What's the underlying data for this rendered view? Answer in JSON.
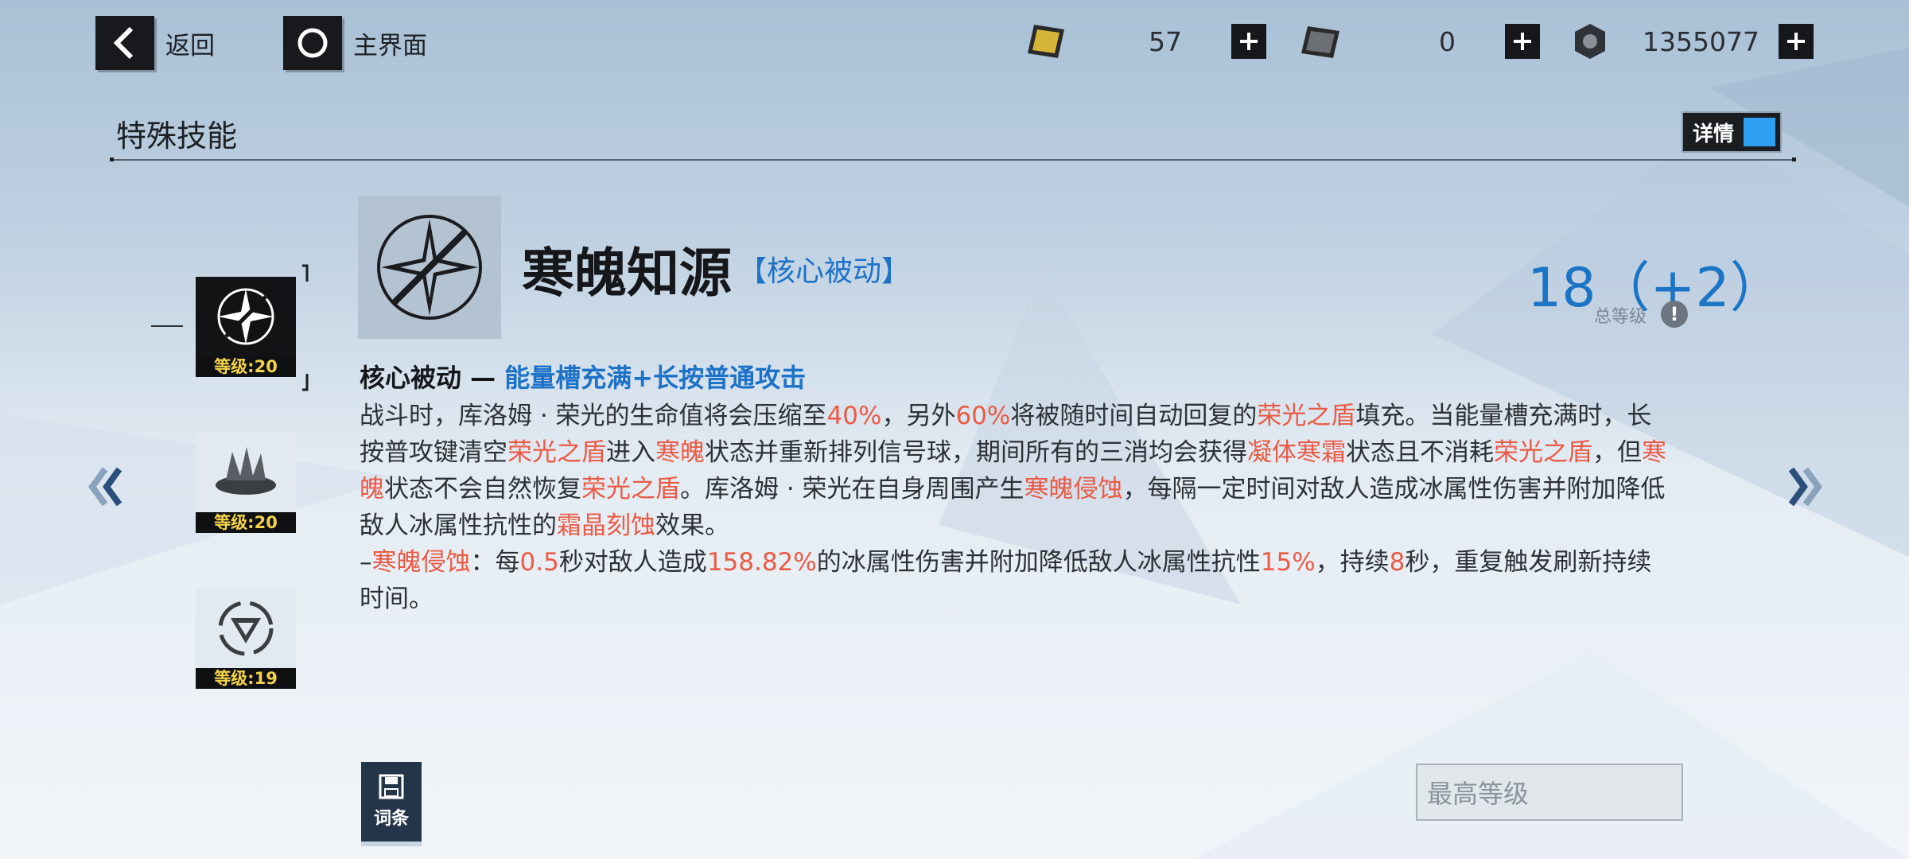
{
  "nav": {
    "back_label": "返回",
    "home_label": "主界面"
  },
  "resources": [
    {
      "name": "gold-ticket",
      "value": "57"
    },
    {
      "name": "dark-ticket",
      "value": "0"
    },
    {
      "name": "gear-coin",
      "value": "1355077"
    }
  ],
  "page": {
    "section_title": "特殊技能",
    "detail_toggle_label": "详情"
  },
  "skills": [
    {
      "level_label": "等级:20",
      "selected": true
    },
    {
      "level_label": "等级:20",
      "selected": false
    },
    {
      "level_label": "等级:19",
      "selected": false
    }
  ],
  "skill_detail": {
    "name": "寒魄知源",
    "type": "【核心被动】",
    "level_display": "18（+2）",
    "level_caption": "总等级",
    "subtitle_prefix": "核心被动 — ",
    "subtitle_highlight": "能量槽充满+长按普通攻击",
    "desc": {
      "s1": "战斗时，库洛姆 · 荣光的生命值将会压缩至",
      "h1": "40%",
      "s2": "，另外",
      "h2": "60%",
      "s3": "将被随时间自动回复的",
      "h3": "荣光之盾",
      "s4": "填充。当能量槽充满时，长按普攻键清空",
      "h4": "荣光之盾",
      "s5": "进入",
      "h5": "寒魄",
      "s6": "状态并重新排列信号球，期间所有的三消均会获得",
      "h6": "凝体寒霜",
      "s7": "状态且不消耗",
      "h7": "荣光之盾",
      "s8": "，但",
      "h8": "寒魄",
      "s9": "状态不会自然恢复",
      "h9": "荣光之盾",
      "s10": "。库洛姆 · 荣光在自身周围产生",
      "h10": "寒魄侵蚀",
      "s11": "，每隔一定时间对敌人造成冰属性伤害并附加降低敌人冰属性抗性的",
      "h11": "霜晶刻蚀",
      "s12": "效果。",
      "l2_s1": "–",
      "l2_h1": "寒魄侵蚀",
      "l2_s2": "：每",
      "l2_h2": "0.5",
      "l2_s3": "秒对敌人造成",
      "l2_h3": "158.82%",
      "l2_s4": "的冰属性伤害并附加降低敌人冰属性抗性",
      "l2_h4": "15%",
      "l2_s5": "，持续",
      "l2_h5": "8",
      "l2_s6": "秒，重复触发刷新持续时间。"
    }
  },
  "footer": {
    "entry_label": "词条",
    "max_level_label": "最高等级"
  },
  "colors": {
    "accent_blue": "#1d72c8",
    "highlight_red": "#ec5a45",
    "level_yellow": "#f3d34a"
  }
}
